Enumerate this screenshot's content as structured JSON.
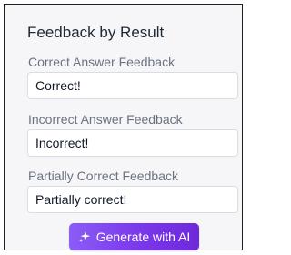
{
  "section": {
    "title": "Feedback by Result"
  },
  "fields": [
    {
      "label": "Correct Answer Feedback",
      "value": "Correct!"
    },
    {
      "label": "Incorrect Answer Feedback",
      "value": "Incorrect!"
    },
    {
      "label": "Partially Correct Feedback",
      "value": "Partially correct!"
    }
  ],
  "actions": {
    "generate_label": "Generate with AI",
    "generate_icon": "sparkle-icon"
  },
  "colors": {
    "panel_background": "#f6f6f8",
    "panel_border": "#1f1f1f",
    "label_text": "#6b7280",
    "button_gradient_start": "#8b5cf6",
    "button_gradient_end": "#6d28d9"
  }
}
